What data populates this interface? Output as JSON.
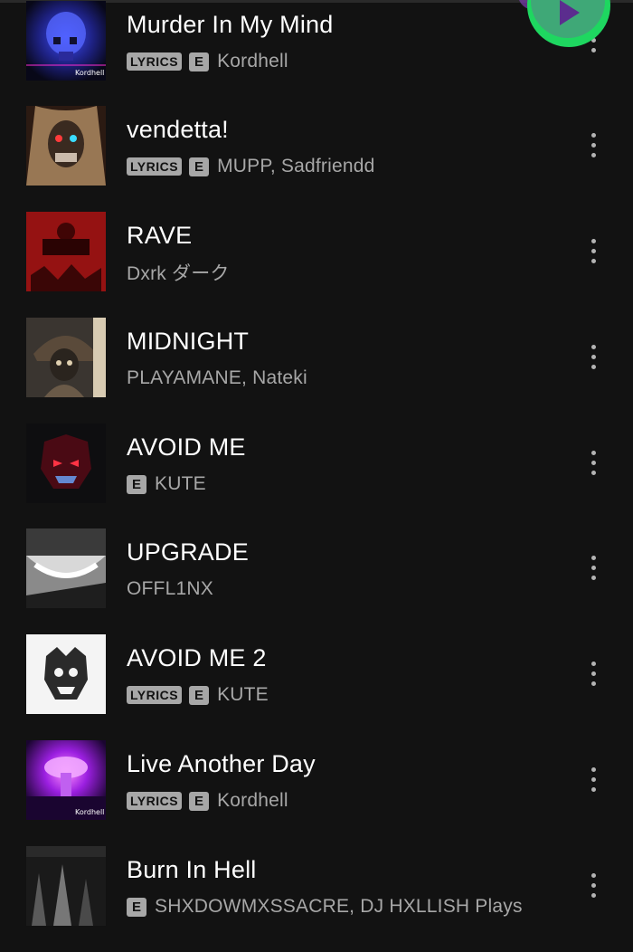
{
  "tracks": [
    {
      "title": "Murder In My Mind",
      "lyrics": "LYRICS",
      "explicit": "E",
      "artists": "Kordhell"
    },
    {
      "title": "vendetta!",
      "lyrics": "LYRICS",
      "explicit": "E",
      "artists": "MUPP, Sadfriendd"
    },
    {
      "title": "RAVE",
      "artists": "Dxrk ダーク"
    },
    {
      "title": "MIDNIGHT",
      "artists": "PLAYAMANE, Nateki"
    },
    {
      "title": "AVOID ME",
      "explicit": "E",
      "artists": "KUTE"
    },
    {
      "title": "UPGRADE",
      "artists": "OFFL1NX"
    },
    {
      "title": "AVOID ME 2",
      "lyrics": "LYRICS",
      "explicit": "E",
      "artists": "KUTE"
    },
    {
      "title": "Live Another Day",
      "lyrics": "LYRICS",
      "explicit": "E",
      "artists": "Kordhell"
    },
    {
      "title": "Burn In Hell",
      "explicit": "E",
      "artists": "SHXDOWMXSSACRE, DJ HXLLISH Plays"
    }
  ],
  "colors": {
    "background": "#121212",
    "text_primary": "#ffffff",
    "text_secondary": "#a7a7a7",
    "accent": "#1ed760"
  },
  "icons": {
    "more": "more-vertical-icon",
    "play": "play-icon"
  }
}
